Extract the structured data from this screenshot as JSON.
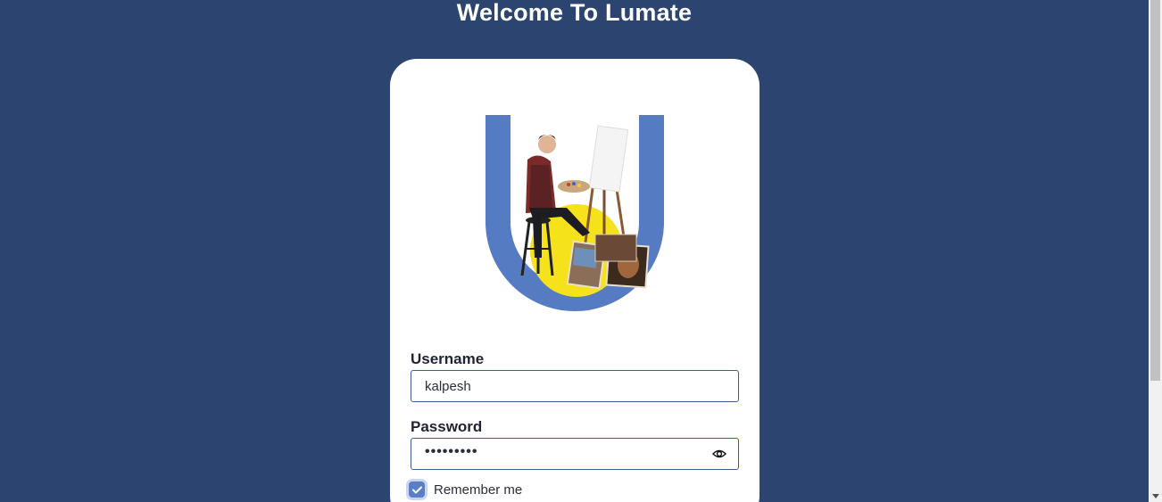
{
  "header": {
    "title": "Welcome To Lumate"
  },
  "logo": {
    "icon": "lumate-u-logo-with-artist",
    "brand_color": "#557bc2",
    "accent_color": "#f5e21a"
  },
  "form": {
    "username": {
      "label": "Username",
      "value": "kalpesh"
    },
    "password": {
      "label": "Password",
      "masked_value": "•••••••••",
      "toggle_icon": "eye-icon"
    },
    "remember": {
      "label": "Remember me",
      "checked": true
    }
  },
  "colors": {
    "background": "#2b4470",
    "card": "#ffffff",
    "input_border": "#3e5f8f",
    "checkbox": "#5a7fc7"
  }
}
